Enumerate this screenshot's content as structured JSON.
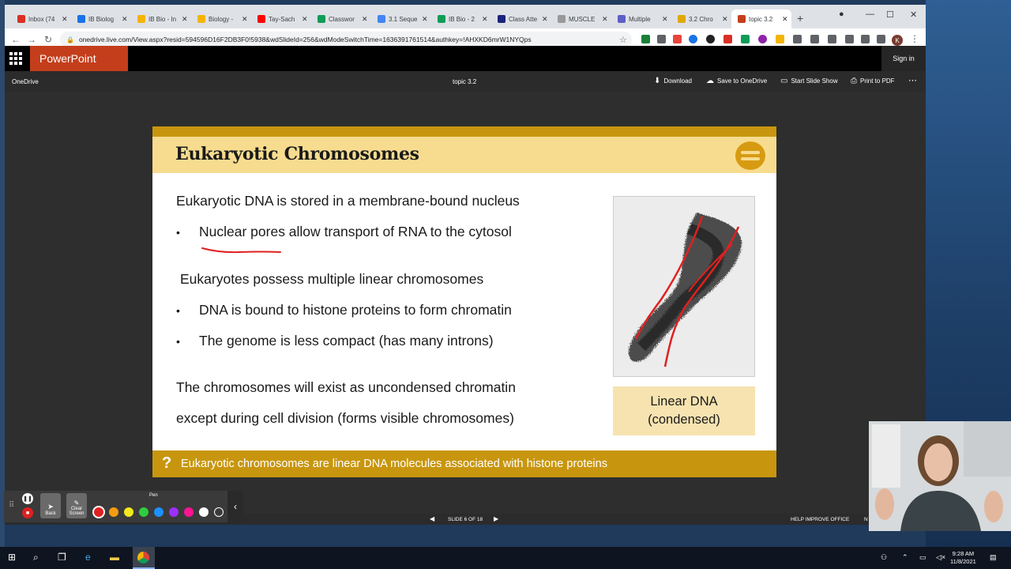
{
  "browser": {
    "tabs": [
      {
        "title": "Inbox (74",
        "color": "#d93025"
      },
      {
        "title": "IB Biolog",
        "color": "#1a73e8"
      },
      {
        "title": "IB Bio - In",
        "color": "#f4b400"
      },
      {
        "title": "Biology -",
        "color": "#f4b400"
      },
      {
        "title": "Tay-Sach",
        "color": "#ff0000"
      },
      {
        "title": "Classwor",
        "color": "#0f9d58"
      },
      {
        "title": "3.1 Seque",
        "color": "#4285f4"
      },
      {
        "title": "IB Bio - 2",
        "color": "#0f9d58"
      },
      {
        "title": "Class Atte",
        "color": "#1a237e"
      },
      {
        "title": "MUSCLE",
        "color": "#999999"
      },
      {
        "title": "Multiple",
        "color": "#5b5fc7"
      },
      {
        "title": "3.2 Chro",
        "color": "#e0a800"
      },
      {
        "title": "topic 3.2",
        "color": "#c43e1c"
      }
    ],
    "url": "onedrive.live.com/View.aspx?resid=594596D16F2DB3F0!5938&wdSlideId=256&wdModeSwitchTime=1636391761514&authkey=!AHXKD6mrW1NYQps",
    "profile_initial": "K"
  },
  "ppt": {
    "app_name": "PowerPoint",
    "sign_in": "Sign in",
    "breadcrumb": "OneDrive",
    "doc_title": "topic 3.2",
    "commands": {
      "download": "Download",
      "save": "Save to OneDrive",
      "slideshow": "Start Slide Show",
      "print": "Print to PDF"
    },
    "status": {
      "slide_indicator": "SLIDE 6 OF 18",
      "help": "HELP IMPROVE OFFICE",
      "notes": "N"
    }
  },
  "slide": {
    "title": "Eukaryotic Chromosomes",
    "line1": "Eukaryotic DNA is stored in a membrane-bound nucleus",
    "bullet1": "Nuclear pores allow transport of RNA to the cytosol",
    "line2": "Eukaryotes possess multiple linear chromosomes",
    "bullet2": "DNA is bound to histone proteins to form chromatin",
    "bullet3": "The genome is less compact (has many introns)",
    "line3a": "The chromosomes will exist as uncondensed chromatin",
    "line3b": "except during cell division (forms visible chromosomes)",
    "caption_line1": "Linear DNA",
    "caption_line2": "(condensed)",
    "footer": "Eukaryotic chromosomes are linear DNA molecules associated with histone proteins",
    "bullet_char": "•",
    "footer_icon": "?"
  },
  "ink_toolbar": {
    "back": "Back",
    "clear": "Clear Screen",
    "pen": "Pen",
    "colors": [
      "#e02020",
      "#f39c12",
      "#f4e81c",
      "#2ecc40",
      "#1e90ff",
      "#9b30ff",
      "#ff1493",
      "#ffffff",
      "#3a3a3a"
    ],
    "ink_color": "#e02020"
  },
  "taskbar": {
    "time": "9:28 AM",
    "date": "11/8/2021"
  },
  "colors": {
    "ppt_brand": "#c43e1c",
    "slide_gold": "#c8960e",
    "slide_title_bg": "#f7dc8f"
  }
}
